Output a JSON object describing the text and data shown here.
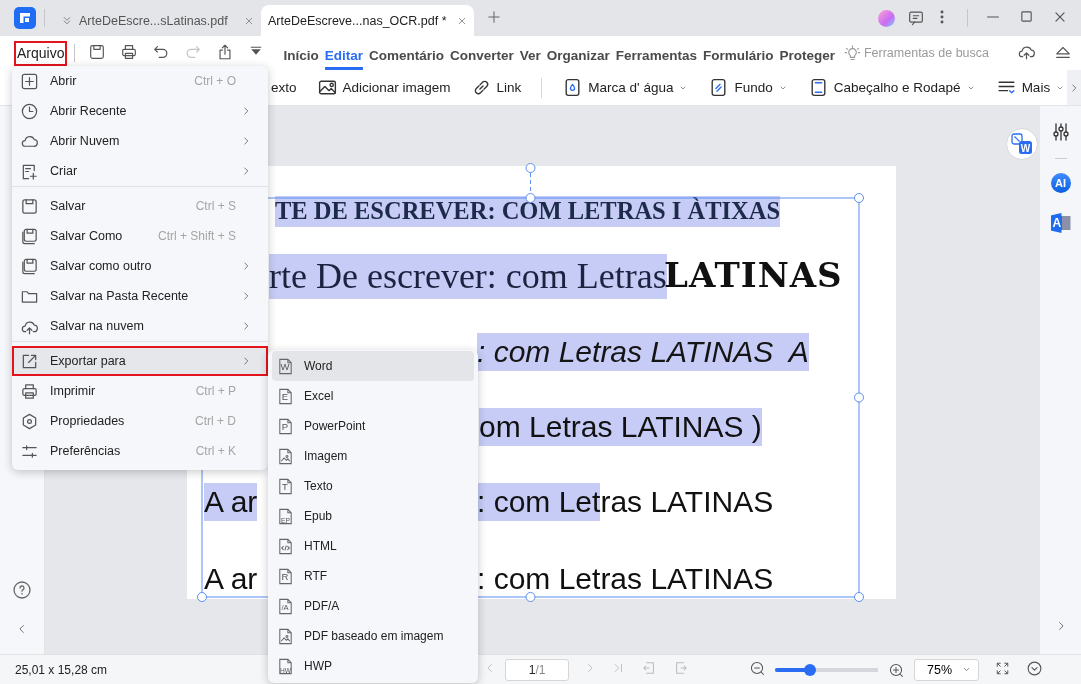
{
  "tabs": [
    {
      "title": "ArteDeEscre...sLatinas.pdf",
      "selected": false
    },
    {
      "title": "ArteDeEscreve...nas_OCR.pdf *",
      "selected": true
    }
  ],
  "file_button": {
    "label": "Arquivo",
    "selected": true
  },
  "nav_tabs": [
    {
      "label": "Início",
      "selected": false
    },
    {
      "label": "Editar",
      "selected": true
    },
    {
      "label": "Comentário",
      "selected": false
    },
    {
      "label": "Converter",
      "selected": false
    },
    {
      "label": "Ver",
      "selected": false
    },
    {
      "label": "Organizar",
      "selected": false
    },
    {
      "label": "Ferramentas",
      "selected": false
    },
    {
      "label": "Formulário",
      "selected": false
    },
    {
      "label": "Proteger",
      "selected": false
    }
  ],
  "search_tools": {
    "label": "Ferramentas de busca"
  },
  "toolbar": [
    {
      "label": "exto",
      "dropdown": false
    },
    {
      "label": "Adicionar imagem",
      "dropdown": false
    },
    {
      "label": "Link",
      "dropdown": false
    },
    {
      "label": "Marca d' água",
      "dropdown": true
    },
    {
      "label": "Fundo",
      "dropdown": true
    },
    {
      "label": "Cabeçalho e Rodapé",
      "dropdown": true
    },
    {
      "label": "Mais",
      "dropdown": true
    }
  ],
  "convert_button": {
    "glyph": "W"
  },
  "right_rail": {
    "ai_glyph": "AI",
    "translate_glyph": "A"
  },
  "document": {
    "lines": [
      {
        "fragments": [
          {
            "text": "TE DE ESCREVER: COM LETRAS I ÀTIXAS",
            "kind": "title",
            "selected": true
          }
        ]
      },
      {
        "fragments": [
          {
            "text": "rte De escrever: com Letras",
            "kind": "serif",
            "selected": true
          },
          {
            "text": "LATINAS",
            "kind": "blackletter",
            "selected": false
          }
        ]
      },
      {
        "fragments": [
          {
            "text": ": com Letras LATINAS  A",
            "kind": "italic",
            "selected": true
          }
        ]
      },
      {
        "fragments": [
          {
            "text": "om Letras LATINAS )",
            "kind": "sans",
            "selected": true
          }
        ]
      },
      {
        "fragments": [
          {
            "text": "A ar",
            "kind": "sans",
            "selected": true
          },
          {
            "text": ": com Let",
            "kind": "sans",
            "selected": true
          },
          {
            "text": "ras LATINAS",
            "kind": "sans",
            "selected": false
          }
        ]
      },
      {
        "fragments": [
          {
            "text": "A ar",
            "kind": "sans",
            "selected": false
          },
          {
            "text": ": com Letras LATINAS",
            "kind": "sans",
            "selected": false
          }
        ]
      }
    ]
  },
  "file_menu": {
    "groups": [
      {
        "items": [
          {
            "label": "Abrir",
            "shortcut": "Ctrl + O",
            "submenu": false,
            "selected": false
          },
          {
            "label": "Abrir Recente",
            "submenu": true,
            "selected": false
          },
          {
            "label": "Abrir Nuvem",
            "submenu": true,
            "selected": false
          },
          {
            "label": "Criar",
            "submenu": true,
            "selected": false
          }
        ]
      },
      {
        "items": [
          {
            "label": "Salvar",
            "shortcut": "Ctrl + S",
            "submenu": false,
            "selected": false
          },
          {
            "label": "Salvar Como",
            "shortcut": "Ctrl + Shift + S",
            "submenu": false,
            "selected": false
          },
          {
            "label": "Salvar como outro",
            "submenu": true,
            "selected": false
          },
          {
            "label": "Salvar na Pasta Recente",
            "submenu": true,
            "selected": false
          },
          {
            "label": "Salvar na nuvem",
            "submenu": true,
            "selected": false
          }
        ]
      },
      {
        "items": [
          {
            "label": "Exportar para",
            "submenu": true,
            "selected": true
          },
          {
            "label": "Imprimir",
            "shortcut": "Ctrl + P",
            "submenu": false,
            "selected": false
          },
          {
            "label": "Propriedades",
            "shortcut": "Ctrl + D",
            "submenu": false,
            "selected": false
          },
          {
            "label": "Preferências",
            "shortcut": "Ctrl + K",
            "submenu": false,
            "selected": false
          }
        ]
      }
    ]
  },
  "export_menu": [
    {
      "label": "Word",
      "kind": "letter",
      "glyph": "W",
      "selected": true
    },
    {
      "label": "Excel",
      "kind": "letter",
      "glyph": "E",
      "selected": false
    },
    {
      "label": "PowerPoint",
      "kind": "letter",
      "glyph": "P",
      "selected": false
    },
    {
      "label": "Imagem",
      "kind": "image",
      "selected": false
    },
    {
      "label": "Texto",
      "kind": "letter",
      "glyph": "T",
      "selected": false
    },
    {
      "label": "Epub",
      "kind": "corner",
      "glyph": "EP",
      "selected": false
    },
    {
      "label": "HTML",
      "kind": "code",
      "selected": false
    },
    {
      "label": "RTF",
      "kind": "letter",
      "glyph": "R",
      "selected": false
    },
    {
      "label": "PDF/A",
      "kind": "letter",
      "glyph": "/A",
      "selected": false
    },
    {
      "label": "PDF baseado em imagem",
      "kind": "image",
      "selected": false
    },
    {
      "label": "HWP",
      "kind": "corner",
      "glyph": "HW",
      "selected": false
    }
  ],
  "status": {
    "size": "25,01 x 15,28 cm",
    "page": "1",
    "page_total": "/1",
    "zoom_slider": {
      "level": 0.34
    },
    "zoom": "75%"
  }
}
